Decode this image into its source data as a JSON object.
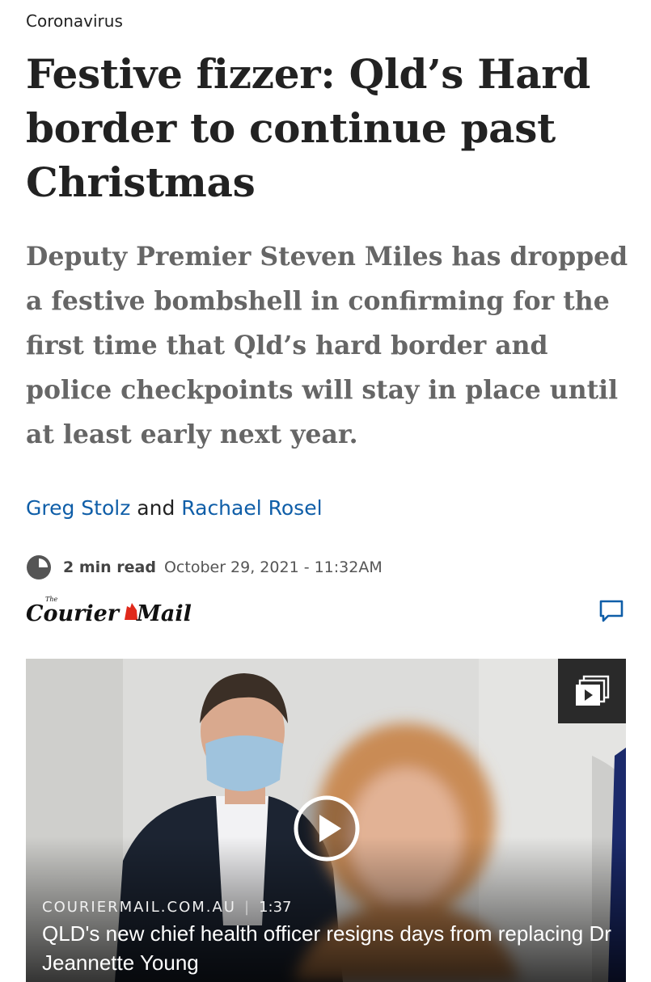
{
  "article": {
    "section": "Coronavirus",
    "headline": "Festive fizzer: Qld’s Hard border to continue past Christmas",
    "standfirst": "Deputy Premier Steven Miles has dropped a festive bombshell in confirming for the first time that Qld’s hard border and police checkpoints will stay in place until at least early next year.",
    "authors": [
      "Greg Stolz",
      "Rachael Rosel"
    ],
    "author_joiner": "and",
    "read_time": "2 min read",
    "published": "October 29, 2021 - 11:32AM"
  },
  "brand": {
    "logo_text": "The Courier Mail",
    "logo_small": "The",
    "logo_main_left": "Courier",
    "logo_main_right": "Mail",
    "accent": "#e0291b"
  },
  "video": {
    "source": "COURIERMAIL.COM.AU",
    "separator": "|",
    "duration": "1:37",
    "title": "QLD's new chief health officer resigns days from replacing Dr Jeannette Young"
  },
  "icons": {
    "clock": "clock-icon",
    "comment": "comment-icon",
    "video_badge": "video-playlist-icon",
    "play": "play-icon"
  },
  "colors": {
    "link": "#0f5ea8",
    "standfirst": "#666666",
    "text": "#222222"
  }
}
